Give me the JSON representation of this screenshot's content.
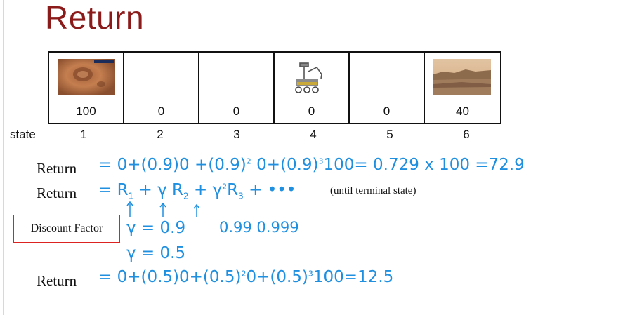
{
  "title": "Return",
  "states": {
    "label": "state",
    "numbers": [
      "1",
      "2",
      "3",
      "4",
      "5",
      "6"
    ],
    "rewards": [
      "100",
      "0",
      "0",
      "0",
      "0",
      "40"
    ],
    "icons": [
      "mars-crater-image",
      "",
      "",
      "rover-icon",
      "",
      "mars-landscape-image"
    ]
  },
  "equations": {
    "return_label": "Return",
    "eq1_prefix": "= 0+(0.9)0 +(0.9)",
    "eq1_mid1": "0+(0.9)",
    "eq1_mid2": "100= 0.729 x 100 =72.9",
    "eq2_prefix": "= R",
    "until_note": "(until terminal state)",
    "discount_label": "Discount Factor",
    "gamma1": "γ = 0.9",
    "gamma_alts": "0.99  0.999",
    "gamma2": "γ = 0.5",
    "eq3": "= 0+(0.5)0+(0.5)",
    "eq3_b": "0+(0.5)",
    "eq3_c": "100=12.5"
  },
  "colors": {
    "title": "#8b1a1a",
    "handwriting": "#1f8fe0",
    "box": "#dd2222"
  }
}
